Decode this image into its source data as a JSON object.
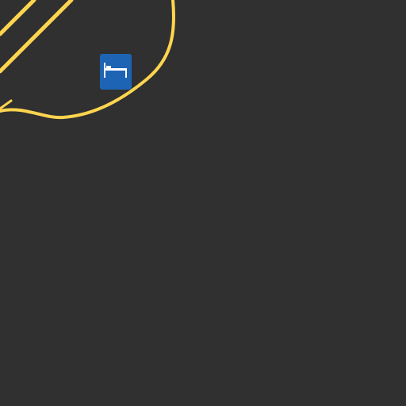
{
  "map": {
    "theme": "dark",
    "colors": {
      "background": "#303030",
      "road": "#FFD54F",
      "poi_background": "#1E64B4",
      "poi_icon": "#FFFFFF"
    },
    "roads": [
      {
        "name": "",
        "class": "major-road-pair"
      },
      {
        "name": "",
        "class": "ramp-loop"
      }
    ],
    "pois": [
      {
        "category": "lodging",
        "icon": "bed-icon",
        "label": ""
      }
    ]
  }
}
